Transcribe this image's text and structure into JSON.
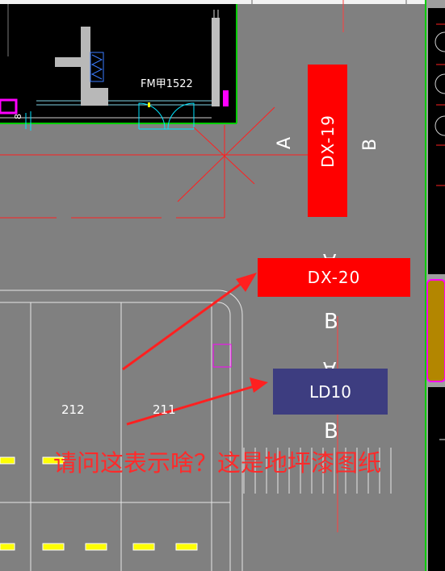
{
  "drawing": {
    "room_label": "FM甲1522",
    "room_number_left": "8",
    "zone_left": "A",
    "zone_right": "B",
    "arrow_label": "A",
    "mid_label": "B",
    "bottom_label": "B",
    "parking_numbers": [
      "212",
      "211"
    ],
    "blocks": [
      {
        "code": "DX-19",
        "color": "#ff0000"
      },
      {
        "code": "DX-20",
        "color": "#ff0000"
      },
      {
        "code": "LD10",
        "color": "#3d3d80"
      }
    ]
  },
  "annotation": {
    "question": "请问这表示啥？这是地坪漆图纸",
    "color": "#ff2a2a"
  },
  "colors": {
    "background": "#808080",
    "building_fill": "#000000",
    "outline_green": "#00cc00",
    "cad_white": "#ffffff",
    "cad_red": "#ff2020",
    "cad_cyan": "#00e5ff",
    "magenta": "#ff00ff",
    "door_yellow": "#ffff00",
    "side_orange": "#b38600"
  }
}
